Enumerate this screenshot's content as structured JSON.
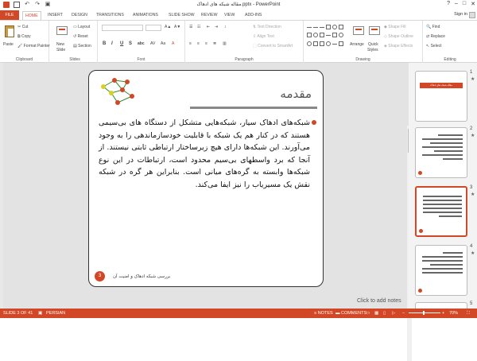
{
  "titlebar": {
    "title": "مقاله شبکه های ادهاک.pptx - PowerPoint",
    "help": "?",
    "minimize": "–",
    "maximize": "□",
    "close": "✕"
  },
  "tabs": {
    "file": "FILE",
    "items": [
      "HOME",
      "INSERT",
      "DESIGN",
      "TRANSITIONS",
      "ANIMATIONS",
      "SLIDE SHOW",
      "REVIEW",
      "VIEW",
      "ADD-INS"
    ],
    "sign_in": "Sign in"
  },
  "ribbon": {
    "clipboard": {
      "paste": "Paste",
      "cut": "Cut",
      "copy": "Copy",
      "format_painter": "Format Painter",
      "label": "Clipboard"
    },
    "slides": {
      "new_slide": "New",
      "new_slide2": "Slide",
      "layout": "Layout",
      "reset": "Reset",
      "section": "Section",
      "label": "Slides"
    },
    "font": {
      "bold": "B",
      "italic": "I",
      "underline": "U",
      "strike": "S",
      "shadow": "abc",
      "label": "Font"
    },
    "paragraph": {
      "text_direction": "Text Direction",
      "align_text": "Align Text",
      "smartart": "Convert to SmartArt",
      "label": "Paragraph"
    },
    "drawing": {
      "arrange": "Arrange",
      "quick_styles": "Quick",
      "quick_styles2": "Styles",
      "shape_fill": "Shape Fill",
      "shape_outline": "Shape Outline",
      "shape_effects": "Shape Effects",
      "label": "Drawing"
    },
    "editing": {
      "find": "Find",
      "replace": "Replace",
      "select": "Select",
      "label": "Editing"
    }
  },
  "slide": {
    "heading": "مقدمه",
    "body": "شبکه‌های ادهاک سیار، شبکه‌هایی متشکل از دستگاه های بی‌سیمی هستند که در کنار هم یک شبکه با قابلیت خودسازماندهی را به وجود می‌آورند. این شبکه‌ها دارای هیچ زیرساختار ارتباطی ثابتی نیستند. از آنجا که برد واسطهای بی‌سیم محدود است، ارتباطات در این نوع شبکه‌ها وابسته به گره‌های میانی است. بنابراین هر گره در شبکه نقش یک مسیریاب را نیز ایفا می‌کند.",
    "footer": "بررسی شبکه ادهاک و امنیت آن",
    "page_number": "3"
  },
  "notes_hint": "Click to add notes",
  "thumbnails": [
    {
      "number": "1",
      "star": "★",
      "label": "مقاله شبکه های ادهاک"
    },
    {
      "number": "2",
      "star": "★"
    },
    {
      "number": "3",
      "star": "★"
    },
    {
      "number": "4",
      "star": "★"
    },
    {
      "number": "5",
      "star": ""
    }
  ],
  "status": {
    "slide": "SLIDE 3 OF 41",
    "language": "PERSIAN",
    "notes": "NOTES",
    "comments": "COMMENTS",
    "zoom": "70%"
  },
  "colors": {
    "accent": "#d24726",
    "slide_bg": "#ffffff",
    "editor_bg": "#e3e3e3"
  }
}
